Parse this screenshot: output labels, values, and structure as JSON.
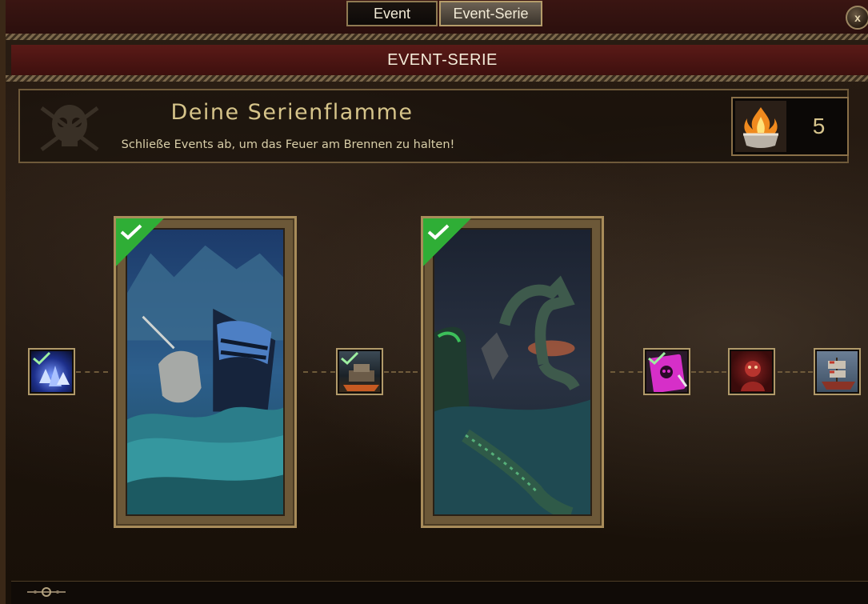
{
  "tabs": [
    {
      "label": "Event",
      "active": false
    },
    {
      "label": "Event-Serie",
      "active": true
    }
  ],
  "close_label": "x",
  "title": "EVENT-SERIE",
  "header": {
    "title": "Deine Serienflamme",
    "subtitle": "Schließe Events ab, um das Feuer am Brennen zu halten!",
    "flame_count": "5"
  },
  "series": [
    {
      "type": "reward",
      "name": "blue-crystals",
      "completed": true
    },
    {
      "type": "event",
      "name": "narwhal-ship-event",
      "completed": true
    },
    {
      "type": "reward",
      "name": "ship-decoration",
      "completed": true
    },
    {
      "type": "event",
      "name": "sea-serpent-event",
      "completed": true
    },
    {
      "type": "reward",
      "name": "pink-skull-flag",
      "completed": true
    },
    {
      "type": "reward",
      "name": "red-figure",
      "completed": false
    },
    {
      "type": "reward",
      "name": "pirate-ship-reward",
      "completed": false
    }
  ],
  "colors": {
    "accent_gold": "#d6c48a",
    "title_bar": "#5a1a17",
    "check_green": "#2fae36",
    "frame_gold": "#a88c5a"
  }
}
